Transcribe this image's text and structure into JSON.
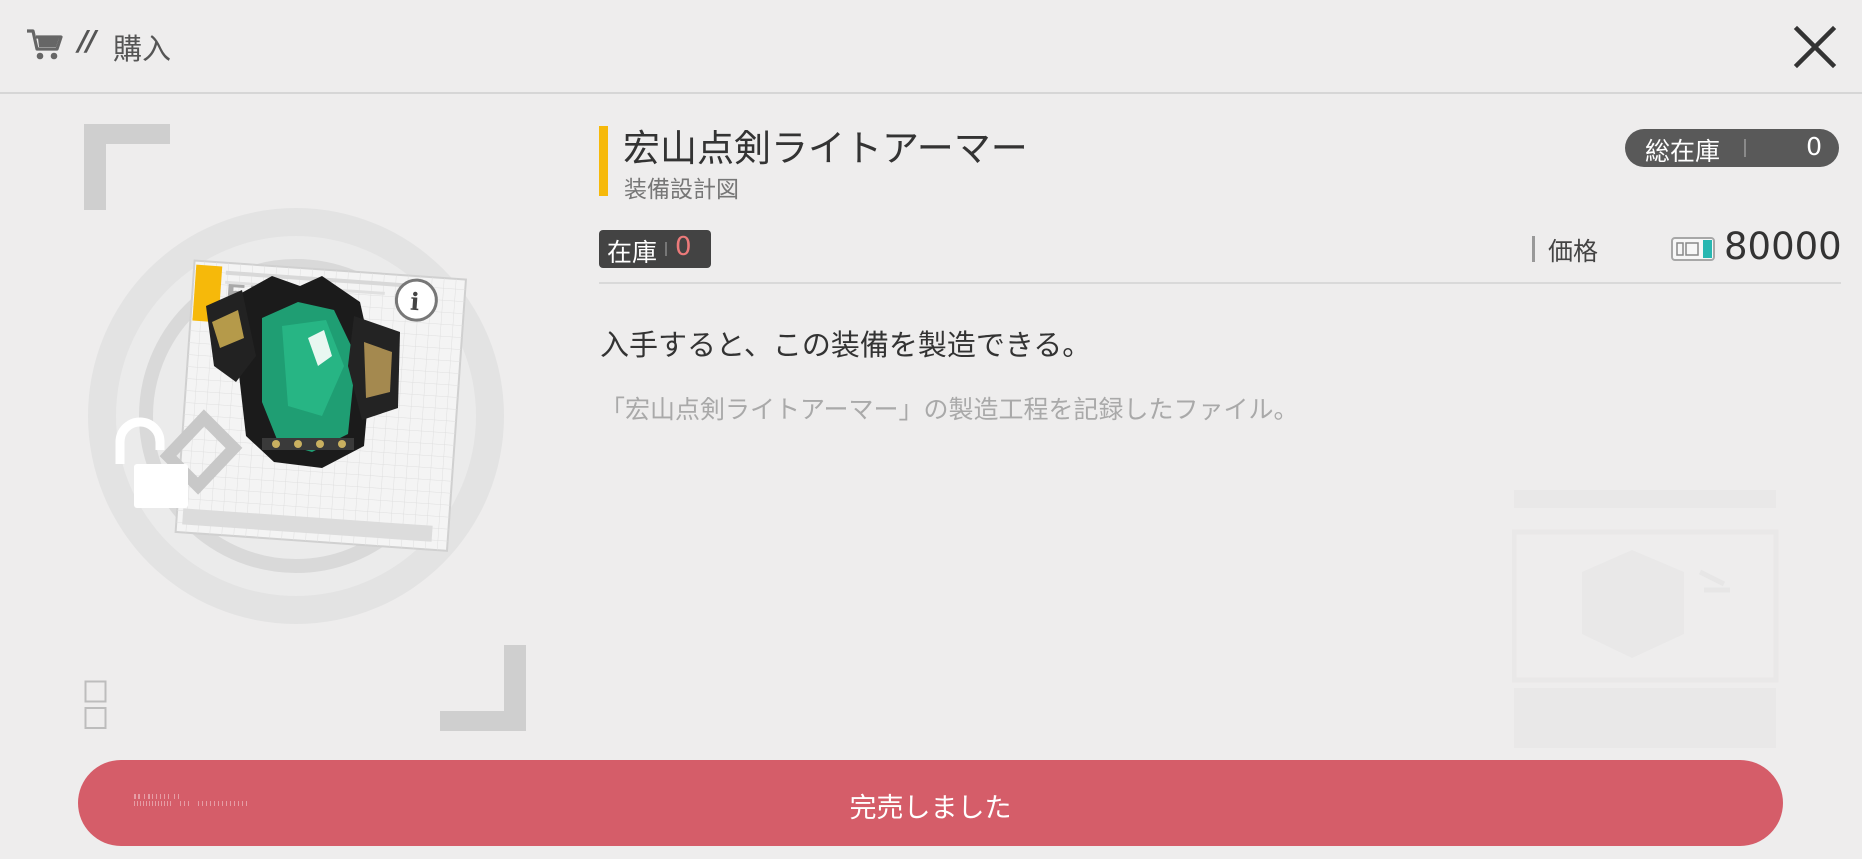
{
  "header": {
    "slashes": "//",
    "title": "購入",
    "icons": {
      "cart": "cart-icon",
      "close": "close-icon"
    }
  },
  "item": {
    "name": "宏山点剣ライトアーマー",
    "type": "装備設計図",
    "total_stock_label": "総在庫",
    "total_stock_value": "0",
    "stock_label": "在庫",
    "stock_value": "0",
    "price_label": "価格",
    "price_value": "80000",
    "description": "入手すると、この装備を製造できる。",
    "lore": "「宏山点剣ライトアーマー」の製造工程を記録したファイル。"
  },
  "buy_button": {
    "label": "完売しました"
  },
  "colors": {
    "accent_yellow": "#f6b90a",
    "button_red": "#d55d69",
    "stock_red": "#ec7a7a",
    "badge_dark": "#434343",
    "background": "#eeeded",
    "armor_green": "#1f9e73"
  }
}
